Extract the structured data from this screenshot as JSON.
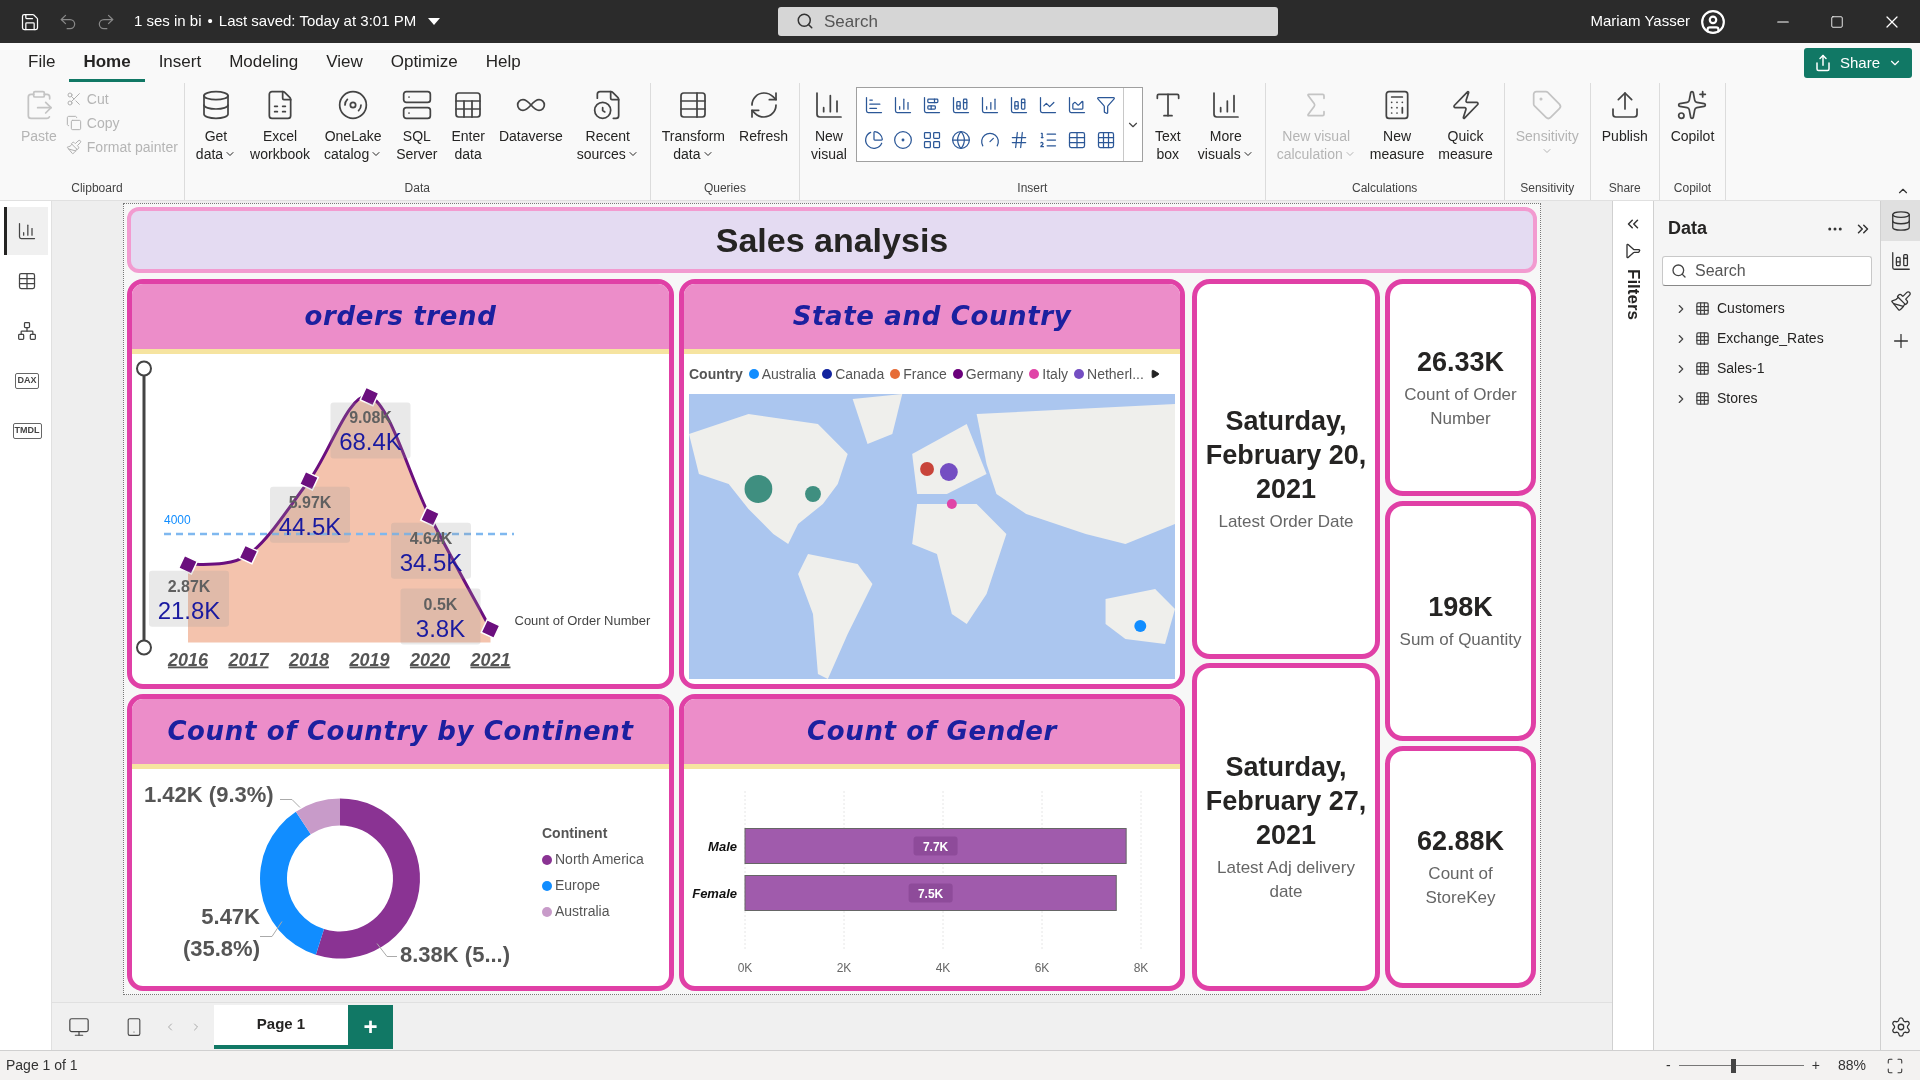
{
  "title_bar": {
    "file_name": "1 ses in bi",
    "separator": "•",
    "saved": "Last saved: Today at 3:01 PM",
    "search": {
      "placeholder": "Search"
    },
    "user": "Mariam Yasser"
  },
  "menu_tabs": [
    {
      "label": "File",
      "selected": false
    },
    {
      "label": "Home",
      "selected": true
    },
    {
      "label": "Insert",
      "selected": false
    },
    {
      "label": "Modeling",
      "selected": false
    },
    {
      "label": "View",
      "selected": false
    },
    {
      "label": "Optimize",
      "selected": false
    },
    {
      "label": "Help",
      "selected": false
    }
  ],
  "share_button": "Share",
  "ribbon": {
    "groups": [
      {
        "label": "Clipboard",
        "items": [
          {
            "kind": "large",
            "lines": [
              "Paste"
            ],
            "dropdown": false,
            "disabled": true
          },
          {
            "kind": "small",
            "lines": [
              "Cut"
            ],
            "dropdown": false,
            "disabled": true
          },
          {
            "kind": "small",
            "lines": [
              "Copy"
            ],
            "dropdown": false,
            "disabled": true
          },
          {
            "kind": "small",
            "lines": [
              "Format painter"
            ],
            "dropdown": false,
            "disabled": true
          }
        ]
      },
      {
        "label": "Data",
        "items": [
          {
            "kind": "large",
            "lines": [
              "Get",
              "data"
            ],
            "dropdown": true,
            "disabled": false
          },
          {
            "kind": "large",
            "lines": [
              "Excel",
              "workbook"
            ],
            "dropdown": false,
            "disabled": false
          },
          {
            "kind": "large",
            "lines": [
              "OneLake",
              "catalog"
            ],
            "dropdown": true,
            "disabled": false
          },
          {
            "kind": "large",
            "lines": [
              "SQL",
              "Server"
            ],
            "dropdown": false,
            "disabled": false
          },
          {
            "kind": "large",
            "lines": [
              "Enter",
              "data"
            ],
            "dropdown": false,
            "disabled": false
          },
          {
            "kind": "large",
            "lines": [
              "Dataverse"
            ],
            "dropdown": false,
            "disabled": false
          },
          {
            "kind": "large",
            "lines": [
              "Recent",
              "sources"
            ],
            "dropdown": true,
            "disabled": false
          }
        ]
      },
      {
        "label": "Queries",
        "items": [
          {
            "kind": "large",
            "lines": [
              "Transform",
              "data"
            ],
            "dropdown": true,
            "disabled": false
          },
          {
            "kind": "large",
            "lines": [
              "Refresh"
            ],
            "dropdown": false,
            "disabled": false
          }
        ]
      },
      {
        "label": "Insert",
        "items": [
          {
            "kind": "large",
            "lines": [
              "New",
              "visual"
            ],
            "dropdown": false,
            "disabled": false
          },
          {
            "kind": "gallery"
          },
          {
            "kind": "large",
            "lines": [
              "Text",
              "box"
            ],
            "dropdown": false,
            "disabled": false
          },
          {
            "kind": "large",
            "lines": [
              "More",
              "visuals"
            ],
            "dropdown": true,
            "disabled": false
          }
        ]
      },
      {
        "label": "Calculations",
        "items": [
          {
            "kind": "large",
            "lines": [
              "New visual",
              "calculation"
            ],
            "dropdown": true,
            "disabled": true
          },
          {
            "kind": "large",
            "lines": [
              "New",
              "measure"
            ],
            "dropdown": false,
            "disabled": false
          },
          {
            "kind": "large",
            "lines": [
              "Quick",
              "measure"
            ],
            "dropdown": false,
            "disabled": false
          }
        ]
      },
      {
        "label": "Sensitivity",
        "items": [
          {
            "kind": "large",
            "lines": [
              "Sensitivity"
            ],
            "dropdown": true,
            "disabled": true
          }
        ]
      },
      {
        "label": "Share",
        "items": [
          {
            "kind": "large",
            "lines": [
              "Publish"
            ],
            "dropdown": false,
            "disabled": false
          }
        ]
      },
      {
        "label": "Copilot",
        "items": [
          {
            "kind": "large",
            "lines": [
              "Copilot"
            ],
            "dropdown": false,
            "disabled": false
          }
        ]
      }
    ]
  },
  "left_rail": [
    {
      "kind": "report",
      "selected": true
    },
    {
      "kind": "table",
      "selected": false
    },
    {
      "kind": "model",
      "selected": false
    },
    {
      "kind": "dax",
      "label": "DAX",
      "selected": false
    },
    {
      "kind": "tmdl",
      "label": "TMDL",
      "selected": false
    }
  ],
  "report_title": "Sales analysis",
  "orders_trend": {
    "title": "orders trend",
    "chart_data": {
      "type": "line",
      "categories": [
        "2016",
        "2017",
        "2018",
        "2019",
        "2020",
        "2021"
      ],
      "series": [
        {
          "name": "Count of Order Number",
          "color": "#6b0f7e",
          "marker": "diamond",
          "values": [
            2870,
            3250,
            5970,
            9080,
            4640,
            500
          ],
          "value_labels": [
            "2.87K",
            null,
            "5.97K",
            "9.08K",
            "4.64K",
            "0.5K"
          ]
        }
      ],
      "value_labels": [
        "21.8K",
        null,
        "44.5K",
        "68.4K",
        "34.5K",
        "3.8K"
      ],
      "ref_lines": [
        {
          "axis": "y",
          "value": 4000,
          "label": "4000"
        }
      ]
    }
  },
  "state_and_country": {
    "title": "State and Country",
    "legend": {
      "title": "Country",
      "items": [
        {
          "label": "Australia",
          "color": "#118dff"
        },
        {
          "label": "Canada",
          "color": "#12239e"
        },
        {
          "label": "France",
          "color": "#e66c37"
        },
        {
          "label": "Germany",
          "color": "#6b007b"
        },
        {
          "label": "Italy",
          "color": "#e044a7"
        },
        {
          "label": "Netherl...",
          "color": "#744ec2"
        }
      ]
    }
  },
  "date_cards": [
    {
      "value": "Saturday, February 20, 2021",
      "label": "Latest Order Date"
    },
    {
      "value": "Saturday, February 27, 2021",
      "label": "Latest Adj delivery date"
    }
  ],
  "kpi_cards": [
    {
      "value": "26.33K",
      "label": "Count of Order Number"
    },
    {
      "value": "198K",
      "label": "Sum of Quantity"
    },
    {
      "value": "62.88K",
      "label": "Count of StoreKey"
    }
  ],
  "continent_chart": {
    "title": "Count of Country by Continent",
    "chart_data": {
      "type": "donut",
      "categories": [
        "North America",
        "Europe",
        "Australia"
      ],
      "values": [
        8380,
        5470,
        1420
      ],
      "colors": [
        "#8a3393",
        "#118dff",
        "#c89bc9"
      ],
      "value_labels": [
        "8.38K (5...)",
        "5.47K (35.8%)",
        "1.42K (9.3%)"
      ],
      "legend": {
        "title": "Continent"
      }
    }
  },
  "gender_chart": {
    "title": "Count of Gender",
    "chart_data": {
      "type": "bar",
      "orientation": "horizontal",
      "categories": [
        "Male",
        "Female"
      ],
      "values": [
        7700,
        7500
      ],
      "color": "#a05bac",
      "xlim": [
        0,
        8000
      ],
      "xticks": [
        {
          "value": 0,
          "label": "0K"
        },
        {
          "value": 2000,
          "label": "2K"
        },
        {
          "value": 4000,
          "label": "4K"
        },
        {
          "value": 6000,
          "label": "6K"
        },
        {
          "value": 8000,
          "label": "8K"
        }
      ],
      "value_labels": [
        "7.7K",
        "7.5K"
      ],
      "grid": true
    }
  },
  "filters_pane": {
    "label": "Filters"
  },
  "data_pane": {
    "title": "Data",
    "search": {
      "placeholder": "Search"
    },
    "tables": [
      {
        "label": "Customers",
        "expanded": false
      },
      {
        "label": "Exchange_Rates",
        "expanded": false
      },
      {
        "label": "Sales-1",
        "expanded": false
      },
      {
        "label": "Stores",
        "expanded": false
      }
    ]
  },
  "right_rail": [
    {
      "kind": "data",
      "selected": true
    },
    {
      "kind": "build",
      "selected": false
    },
    {
      "kind": "format",
      "selected": false
    },
    {
      "kind": "add",
      "selected": false
    }
  ],
  "page_bar": {
    "pages": [
      {
        "label": "Page 1",
        "selected": true
      }
    ],
    "add_button": "+"
  },
  "status_bar": {
    "page_info": "Page 1 of 1",
    "zoom": {
      "minus": "-",
      "plus": "+",
      "level": 0.43,
      "reading": "88%"
    }
  }
}
